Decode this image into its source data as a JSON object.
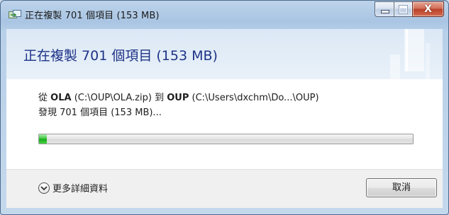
{
  "window": {
    "title": "正在複製 701 個項目 (153 MB)",
    "caption_close_glyph": "X"
  },
  "header": {
    "title": "正在複製 701 個項目 (153 MB)"
  },
  "copy": {
    "from_word": "從",
    "source_name": "OLA",
    "source_path": "(C:\\OUP\\OLA.zip)",
    "to_word": "到",
    "dest_name": "OUP",
    "dest_path": "(C:\\Users\\dxchm\\Do...\\OUP)",
    "status": "發現 701 個項目 (153 MB)..."
  },
  "progress": {
    "fraction": 0.01
  },
  "footer": {
    "more_details_label": "更多詳細資料",
    "cancel_label": "取消"
  },
  "icons": {
    "app": "copy-icon",
    "chevron": "chevron-down-icon"
  },
  "colors": {
    "header_title": "#1e3287",
    "progress_fill": "#22b422",
    "close_button": "#c4462e"
  }
}
